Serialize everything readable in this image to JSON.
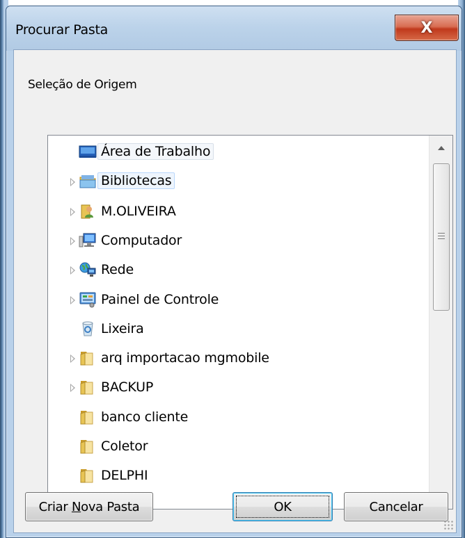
{
  "window": {
    "title": "Procurar Pasta",
    "close_glyph": "X"
  },
  "dialog": {
    "subtitle": "Seleção de Origem"
  },
  "tree": {
    "items": [
      {
        "label": "Área de Trabalho",
        "icon": "desktop-icon",
        "expander": false,
        "state": "selected"
      },
      {
        "label": "Bibliotecas",
        "icon": "libraries-icon",
        "expander": true,
        "state": "hover"
      },
      {
        "label": "M.OLIVEIRA",
        "icon": "user-folder-icon",
        "expander": true,
        "state": ""
      },
      {
        "label": "Computador",
        "icon": "computer-icon",
        "expander": true,
        "state": ""
      },
      {
        "label": "Rede",
        "icon": "network-icon",
        "expander": true,
        "state": ""
      },
      {
        "label": "Painel de Controle",
        "icon": "control-panel-icon",
        "expander": true,
        "state": ""
      },
      {
        "label": "Lixeira",
        "icon": "recycle-bin-icon",
        "expander": false,
        "state": ""
      },
      {
        "label": "arq importacao mgmobile",
        "icon": "folder-icon",
        "expander": true,
        "state": ""
      },
      {
        "label": "BACKUP",
        "icon": "folder-icon",
        "expander": true,
        "state": ""
      },
      {
        "label": "banco cliente",
        "icon": "folder-icon",
        "expander": false,
        "state": ""
      },
      {
        "label": "Coletor",
        "icon": "folder-icon",
        "expander": false,
        "state": ""
      },
      {
        "label": "DELPHI",
        "icon": "folder-icon",
        "expander": false,
        "state": ""
      }
    ]
  },
  "buttons": {
    "new_folder_prefix": "Criar ",
    "new_folder_accel": "N",
    "new_folder_suffix": "ova Pasta",
    "ok": "OK",
    "cancel": "Cancelar"
  },
  "colors": {
    "frame": "#b9d1ea",
    "client": "#f0f0f0",
    "close_button": "#c7462a",
    "folder": "#e8c454"
  }
}
